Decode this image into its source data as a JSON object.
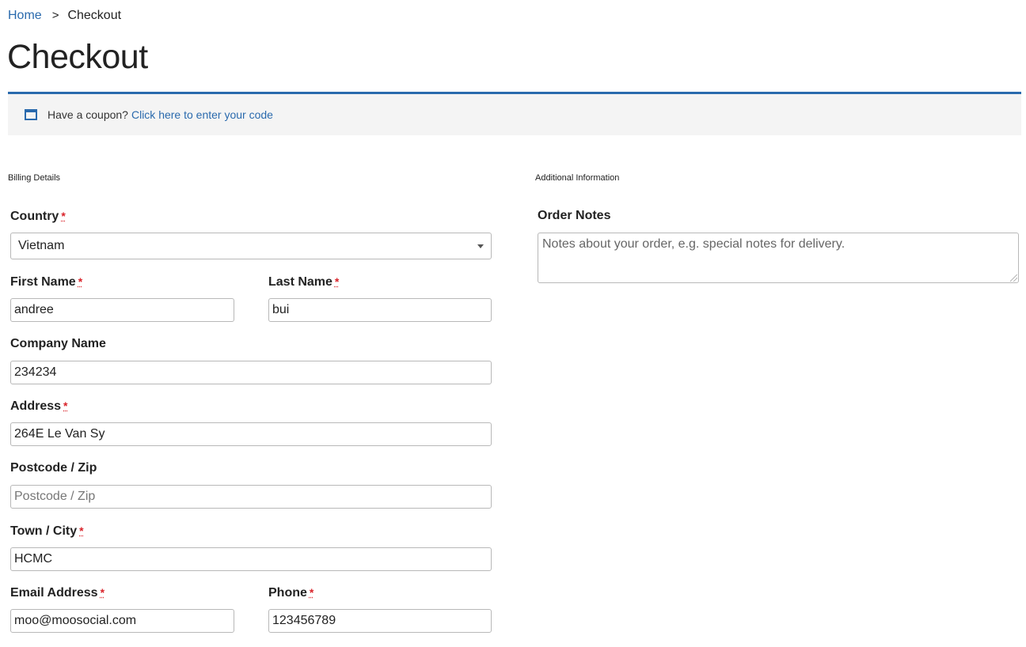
{
  "breadcrumb": {
    "home": "Home",
    "separator": ">",
    "current": "Checkout"
  },
  "page": {
    "title": "Checkout"
  },
  "coupon": {
    "icon": "calendar-icon",
    "prompt": "Have a coupon?",
    "link": "Click here to enter your code"
  },
  "billing": {
    "heading": "Billing Details",
    "required_marker": "*",
    "country": {
      "label": "Country",
      "value": "Vietnam"
    },
    "first_name": {
      "label": "First Name",
      "value": "andree"
    },
    "last_name": {
      "label": "Last Name",
      "value": "bui"
    },
    "company": {
      "label": "Company Name",
      "value": "234234"
    },
    "address": {
      "label": "Address",
      "value": "264E Le Van Sy"
    },
    "postcode": {
      "label": "Postcode / Zip",
      "value": "",
      "placeholder": "Postcode / Zip"
    },
    "city": {
      "label": "Town / City",
      "value": "HCMC"
    },
    "email": {
      "label": "Email Address",
      "value": "moo@moosocial.com"
    },
    "phone": {
      "label": "Phone",
      "value": "123456789"
    }
  },
  "additional": {
    "heading": "Additional Information",
    "order_notes": {
      "label": "Order Notes",
      "placeholder": "Notes about your order, e.g. special notes for delivery."
    }
  },
  "colors": {
    "accent": "#2a6aad",
    "required": "#d9232a",
    "coupon_bg": "#f4f4f4"
  }
}
